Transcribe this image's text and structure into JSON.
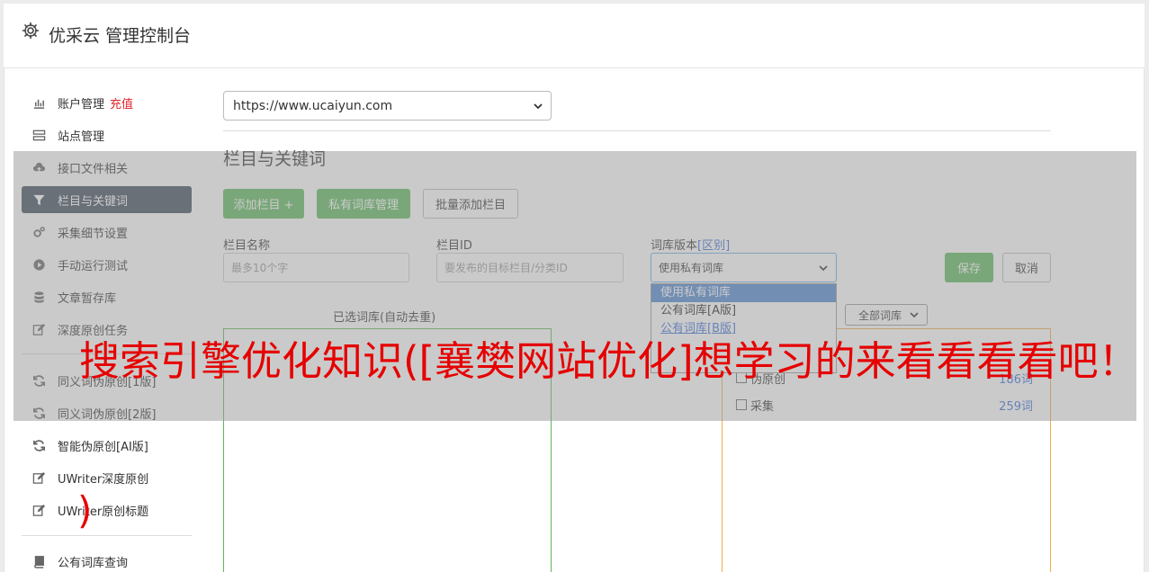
{
  "header": {
    "title": "优采云 管理控制台",
    "icon": "gear-icon"
  },
  "sidebar": {
    "items": [
      {
        "label": "账户管理",
        "badge": "充值",
        "icon": "bar-chart-icon"
      },
      {
        "label": "站点管理",
        "icon": "server-icon"
      },
      {
        "label": "接口文件相关",
        "icon": "cloud-upload-icon"
      },
      {
        "label": "栏目与关键词",
        "icon": "filter-icon",
        "active": true
      },
      {
        "label": "采集细节设置",
        "icon": "cogs-icon"
      },
      {
        "label": "手动运行测试",
        "icon": "play-circle-icon"
      },
      {
        "label": "文章暂存库",
        "icon": "database-icon"
      },
      {
        "label": "深度原创任务",
        "icon": "edit-icon"
      },
      {
        "label": "同义词伪原创[1版]",
        "icon": "refresh-icon"
      },
      {
        "label": "同义词伪原创[2版]",
        "icon": "refresh-icon"
      },
      {
        "label": "智能伪原创[AI版]",
        "icon": "refresh-icon"
      },
      {
        "label": "UWriter深度原创",
        "icon": "edit-icon"
      },
      {
        "label": "UWriter原创标题",
        "icon": "edit-icon"
      },
      {
        "label": "公有词库查询",
        "icon": "book-icon"
      }
    ]
  },
  "main": {
    "site_select": "https://www.ucaiyun.com",
    "section_title": "栏目与关键词",
    "buttons": {
      "add_column": "添加栏目 +",
      "private_lib": "私有词库管理",
      "batch_add": "批量添加栏目"
    },
    "form": {
      "name_label": "栏目名称",
      "name_placeholder": "最多10个字",
      "id_label": "栏目ID",
      "id_placeholder": "要发布的目标栏目/分类ID",
      "version_label": "词库版本",
      "version_link": "[区别]",
      "version_value": "使用私有词库",
      "save": "保存",
      "cancel": "取消"
    },
    "dropdown_options": [
      "使用私有词库",
      "公有词库[A版]",
      "公有词库[B版]"
    ],
    "selected_caption": "已选词库(自动去重)",
    "lib_filter": "全部词库",
    "libraries": [
      {
        "name": "伪原创",
        "count": "186词"
      },
      {
        "name": "采集",
        "count": "259词"
      }
    ]
  },
  "watermark": {
    "text": "搜索引擎优化知识([襄樊网站优化]想学习的来看看看看吧！",
    "paren": ")"
  },
  "colors": {
    "green": "#5cb85c",
    "orange": "#f0ad4e",
    "red": "#e60000",
    "active_nav": "#3e4a5a",
    "link": "#3a6fd8"
  }
}
